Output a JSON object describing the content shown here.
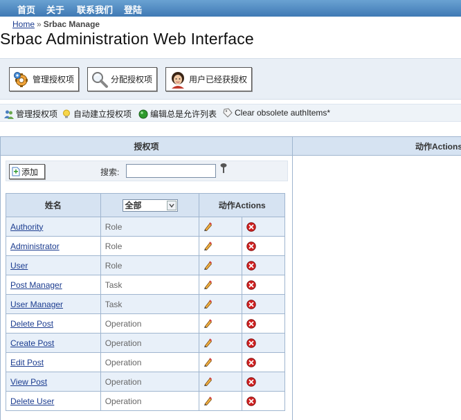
{
  "topnav": {
    "items": [
      "首页",
      "关于",
      "联系我们",
      "登陆"
    ]
  },
  "breadcrumb": {
    "home": "Home",
    "separator": "»",
    "current": "Srbac Manage"
  },
  "page_title": "Srbac Administration Web Interface",
  "toolbar": {
    "buttons": [
      {
        "label": "管理授权项",
        "icon": "gears-icon"
      },
      {
        "label": "分配授权项",
        "icon": "magnifier-icon"
      },
      {
        "label": "用户已经获授权",
        "icon": "user-face-icon"
      }
    ]
  },
  "subbar": {
    "items": [
      {
        "label": "管理授权项",
        "icon": "users-icon"
      },
      {
        "label": "自动建立授权项",
        "icon": "lightbulb-icon"
      },
      {
        "label": "编辑总是允许列表",
        "icon": "green-dot-icon"
      },
      {
        "label": "Clear obsolete authItems*",
        "icon": "tag-icon"
      }
    ]
  },
  "left_panel": {
    "title": "授权项",
    "add_label": "添加",
    "search_label": "搜索:",
    "search_value": "",
    "table": {
      "col_name": "姓名",
      "filter_value": "全部",
      "col_actions": "动作Actions",
      "rows": [
        {
          "name": "Authority",
          "type": "Role"
        },
        {
          "name": "Administrator",
          "type": "Role"
        },
        {
          "name": "User",
          "type": "Role"
        },
        {
          "name": "Post Manager",
          "type": "Task"
        },
        {
          "name": "User Manager",
          "type": "Task"
        },
        {
          "name": "Delete Post",
          "type": "Operation"
        },
        {
          "name": "Create Post",
          "type": "Operation"
        },
        {
          "name": "Edit Post",
          "type": "Operation"
        },
        {
          "name": "View Post",
          "type": "Operation"
        },
        {
          "name": "Delete User",
          "type": "Operation"
        }
      ]
    }
  },
  "right_panel": {
    "title": "动作Actions"
  },
  "colors": {
    "nav": "#3f79b4",
    "header_bg": "#d6e3f2",
    "border": "#9fb5cf",
    "link": "#1a3b8f",
    "delete_red": "#d02020"
  }
}
